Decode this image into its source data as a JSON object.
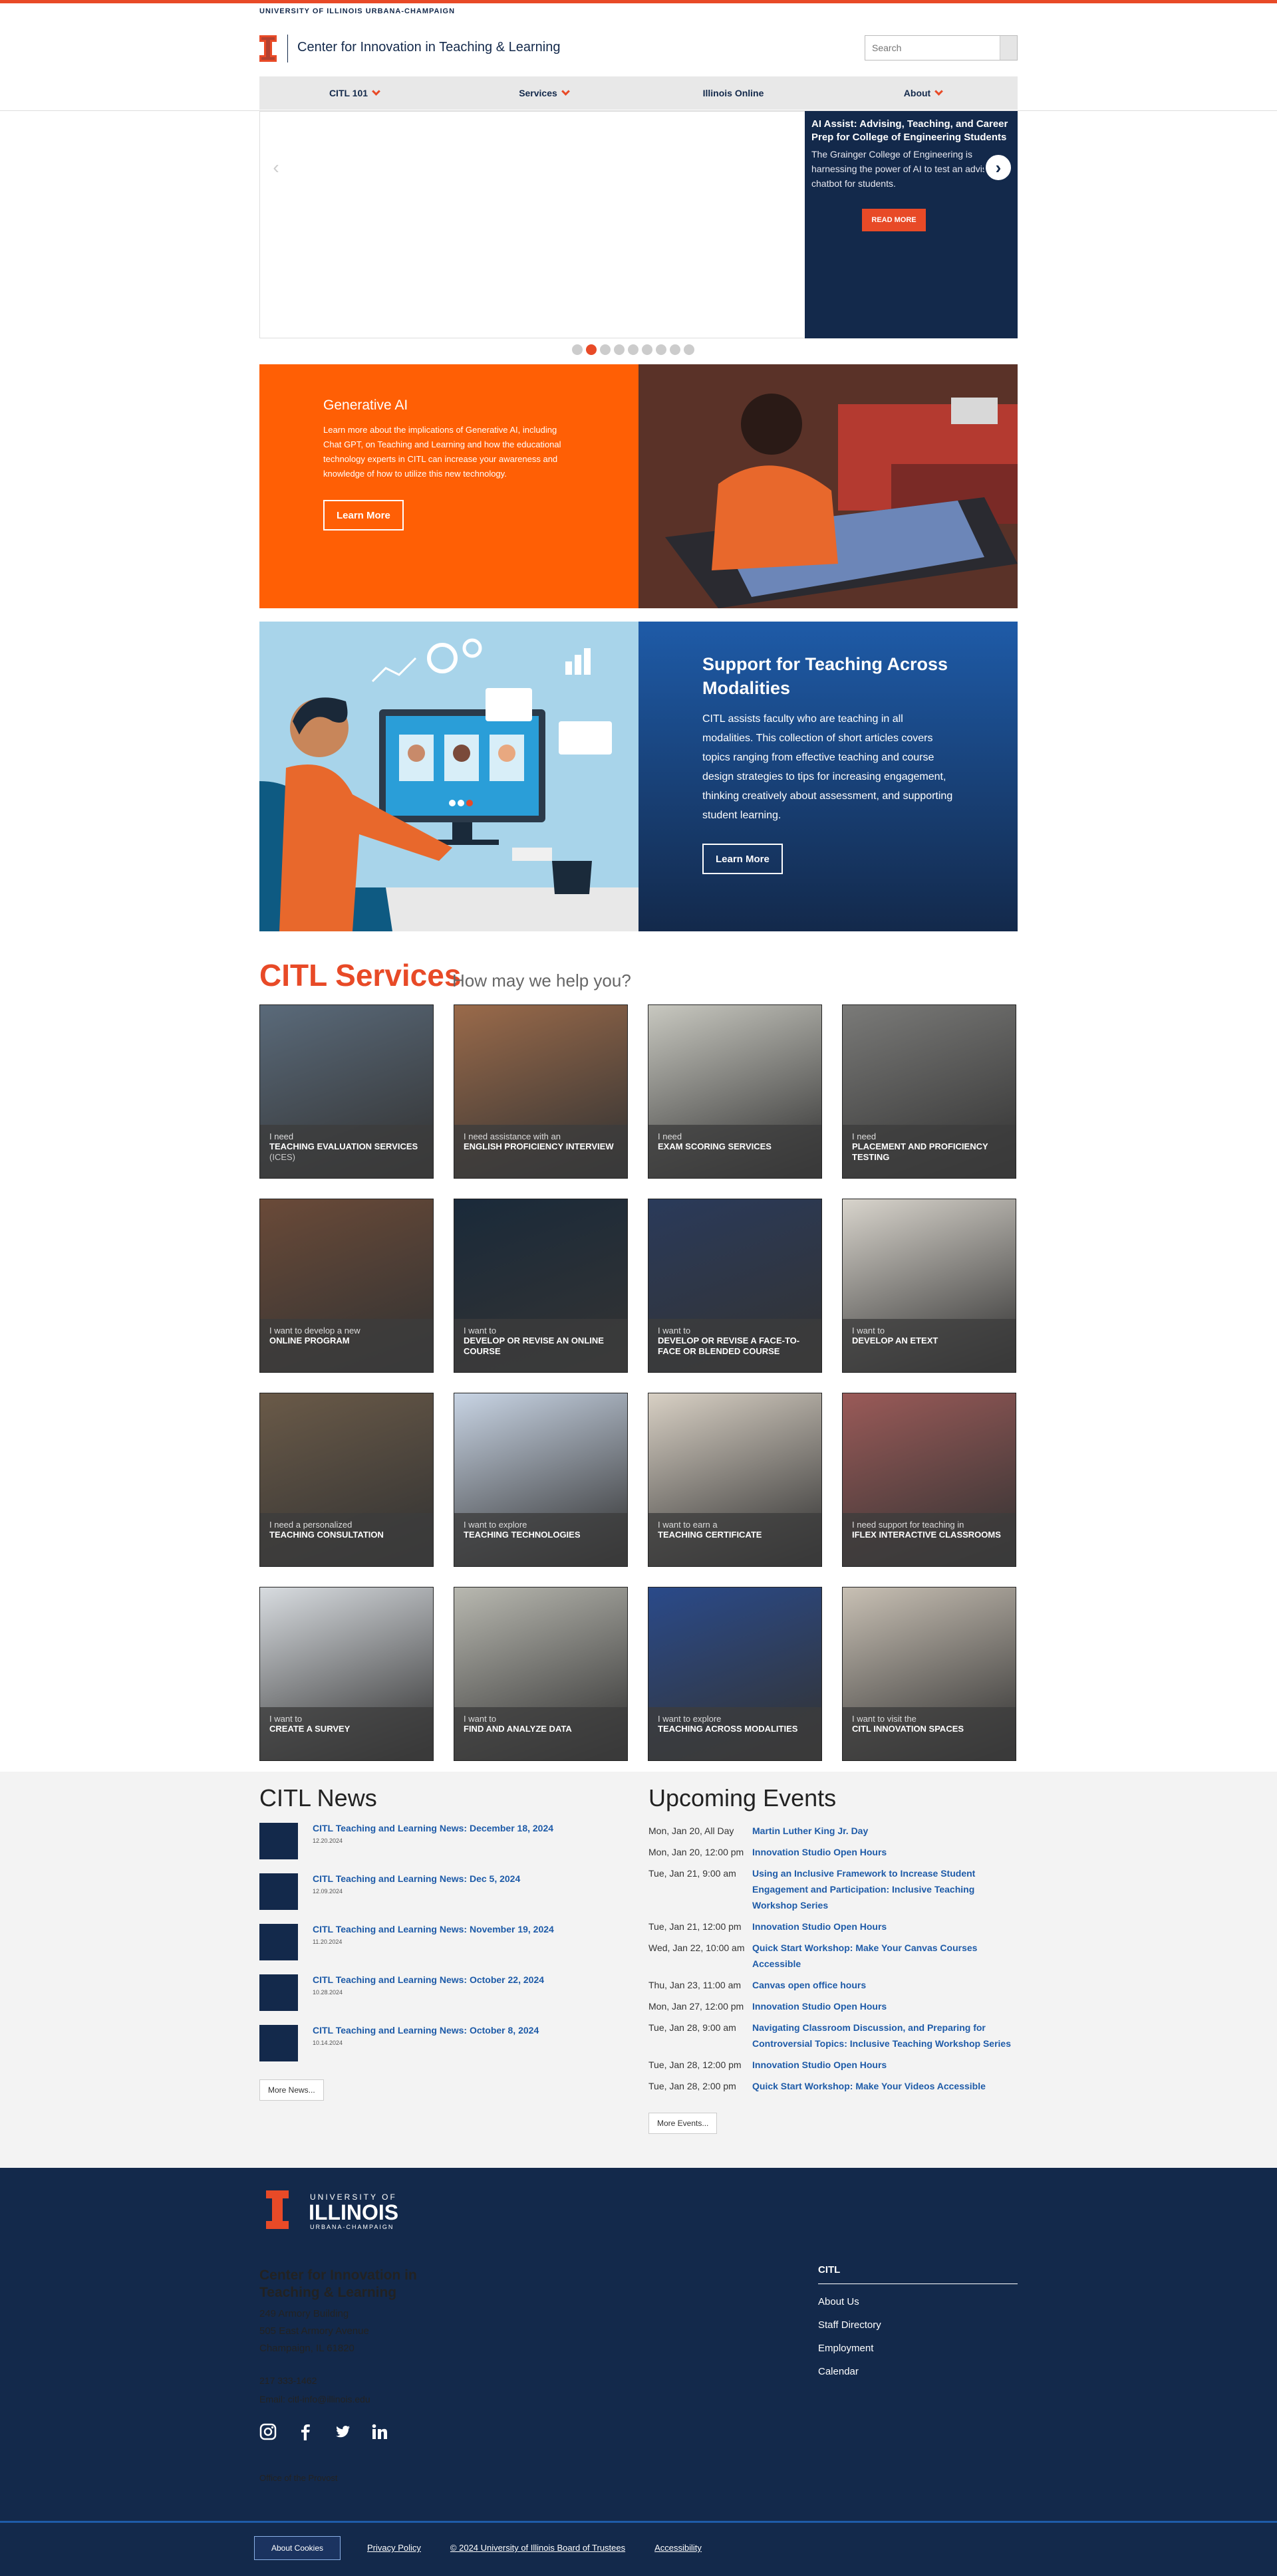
{
  "header": {
    "university": "UNIVERSITY OF ILLINOIS URBANA-CHAMPAIGN",
    "site_title": "Center for Innovation in Teaching & Learning",
    "search_placeholder": "Search"
  },
  "nav": [
    {
      "label": "CITL 101",
      "has_dropdown": true
    },
    {
      "label": "Services",
      "has_dropdown": true
    },
    {
      "label": "Illinois Online",
      "has_dropdown": false
    },
    {
      "label": "About",
      "has_dropdown": true
    }
  ],
  "slider": {
    "title": "AI Assist: Advising, Teaching, and Career Prep for College of Engineering Students",
    "text": "The Grainger College of Engineering is harnessing the power of AI to test an advising chatbot for students.",
    "button": "READ MORE",
    "slide_count": 9,
    "active_slide": 2
  },
  "promo_genai": {
    "title": "Generative AI",
    "text": "Learn more about the implications of Generative AI, including Chat GPT, on Teaching and Learning and how the educational technology experts in CITL can increase your awareness and knowledge of how to utilize this new technology.",
    "button": "Learn More"
  },
  "promo_modalities": {
    "title": "Support for Teaching Across Modalities",
    "text": "CITL assists faculty who are teaching in all modalities. This collection of short articles covers topics ranging from effective teaching and course design strategies to tips for increasing engagement, thinking creatively about assessment, and supporting student learning.",
    "button": "Learn More"
  },
  "services": {
    "title": "CITL Services",
    "subtitle": "How may we help you?",
    "tiles": [
      {
        "lead": "I need",
        "title": "TEACHING EVALUATION SERVICES",
        "suffix": "(ICES)",
        "color": "#5a6a7a"
      },
      {
        "lead": "I need assistance with an",
        "title": "ENGLISH PROFICIENCY INTERVIEW",
        "suffix": "",
        "color": "#9a6a4a"
      },
      {
        "lead": "I need",
        "title": "EXAM SCORING SERVICES",
        "suffix": "",
        "color": "#c8c8c0"
      },
      {
        "lead": "I need",
        "title": "PLACEMENT AND PROFICIENCY TESTING",
        "suffix": "",
        "color": "#7a7a78"
      },
      {
        "lead": "I want to develop a new",
        "title": "ONLINE PROGRAM",
        "suffix": "",
        "color": "#6a4a38"
      },
      {
        "lead": "I want to",
        "title": "DEVELOP OR REVISE AN ONLINE COURSE",
        "suffix": "",
        "color": "#1a2a3a"
      },
      {
        "lead": "I want to",
        "title": "DEVELOP OR REVISE A FACE-TO-FACE OR BLENDED COURSE",
        "suffix": "",
        "color": "#2a3a5a"
      },
      {
        "lead": "I want to",
        "title": "DEVELOP AN ETEXT",
        "suffix": "",
        "color": "#d8d4cc"
      },
      {
        "lead": "I need a personalized",
        "title": "TEACHING CONSULTATION",
        "suffix": "",
        "color": "#6a5a48"
      },
      {
        "lead": "I want to explore",
        "title": "TEACHING TECHNOLOGIES",
        "suffix": "",
        "color": "#c8d4e4"
      },
      {
        "lead": "I want to earn a",
        "title": "TEACHING CERTIFICATE",
        "suffix": "",
        "color": "#d8d0c4"
      },
      {
        "lead": "I need support for teaching in",
        "title": "IFLEX INTERACTIVE CLASSROOMS",
        "suffix": "",
        "color": "#9a5a58"
      },
      {
        "lead": "I want to",
        "title": "CREATE A SURVEY",
        "suffix": "",
        "color": "#d8dce0"
      },
      {
        "lead": "I want to",
        "title": "FIND AND ANALYZE DATA",
        "suffix": "",
        "color": "#b8b8b0"
      },
      {
        "lead": "I want to explore",
        "title": "TEACHING ACROSS MODALITIES",
        "suffix": "",
        "color": "#2a4a8a"
      },
      {
        "lead": "I want to visit the",
        "title": "CITL INNOVATION SPACES",
        "suffix": "",
        "color": "#c8c0b4"
      }
    ]
  },
  "news": {
    "title": "CITL News",
    "items": [
      {
        "title": "CITL Teaching and Learning News: December 18, 2024",
        "date": "12.20.2024"
      },
      {
        "title": "CITL Teaching and Learning News: Dec 5, 2024",
        "date": "12.09.2024"
      },
      {
        "title": "CITL Teaching and Learning News: November 19, 2024",
        "date": "11.20.2024"
      },
      {
        "title": "CITL Teaching and Learning News: October 22, 2024",
        "date": "10.28.2024"
      },
      {
        "title": "CITL Teaching and Learning News: October 8, 2024",
        "date": "10.14.2024"
      }
    ],
    "more": "More News..."
  },
  "events": {
    "title": "Upcoming Events",
    "items": [
      {
        "when": "Mon, Jan 20, All Day",
        "name": "Martin Luther King Jr. Day"
      },
      {
        "when": "Mon, Jan 20, 12:00 pm",
        "name": "Innovation Studio Open Hours"
      },
      {
        "when": "Tue, Jan 21, 9:00 am",
        "name": "Using an Inclusive Framework to Increase Student Engagement and Participation: Inclusive Teaching Workshop Series"
      },
      {
        "when": "Tue, Jan 21, 12:00 pm",
        "name": "Innovation Studio Open Hours"
      },
      {
        "when": "Wed, Jan 22, 10:00 am",
        "name": "Quick Start Workshop: Make Your Canvas Courses Accessible"
      },
      {
        "when": "Thu, Jan 23, 11:00 am",
        "name": "Canvas open office hours"
      },
      {
        "when": "Mon, Jan 27, 12:00 pm",
        "name": "Innovation Studio Open Hours"
      },
      {
        "when": "Tue, Jan 28, 9:00 am",
        "name": "Navigating Classroom Discussion, and Preparing for Controversial Topics: Inclusive Teaching Workshop Series"
      },
      {
        "when": "Tue, Jan 28, 12:00 pm",
        "name": "Innovation Studio Open Hours"
      },
      {
        "when": "Tue, Jan 28, 2:00 pm",
        "name": "Quick Start Workshop: Make Your Videos Accessible"
      }
    ],
    "more": "More Events..."
  },
  "footer": {
    "logo_line1": "UNIVERSITY OF",
    "logo_line2": "ILLINOIS",
    "logo_line3": "URBANA-CHAMPAIGN",
    "name": "Center for Innovation in Teaching & Learning",
    "address": [
      "249 Armory Building",
      "505 East Armory Avenue",
      "Champaign, IL 61820"
    ],
    "phone": "217 333-1462",
    "email": "Email: citl-info@illinois.edu",
    "social": [
      "instagram-icon",
      "facebook-icon",
      "twitter-icon",
      "linkedin-icon"
    ],
    "provost": "Office of the Provost",
    "col_title": "CITL",
    "links": [
      "About Us",
      "Staff Directory",
      "Employment",
      "Calendar"
    ]
  },
  "bottom": {
    "cookies": "About Cookies",
    "links": [
      "Privacy Policy",
      "© 2024 University of Illinois Board of Trustees",
      "Accessibility"
    ]
  },
  "colors": {
    "orange": "#e84a27",
    "navy": "#13294b",
    "blue": "#1e5ba8",
    "genai_orange": "#ff5f05"
  }
}
